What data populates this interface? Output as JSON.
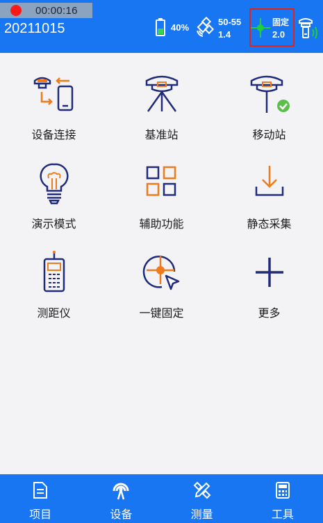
{
  "status_bar": {
    "recording_time": "00:00:16",
    "project_name": "20211015",
    "battery_percent": "40%",
    "satellites": "50-55",
    "pdop": "1.4",
    "fix_status": "固定",
    "fix_value": "2.0"
  },
  "menu": {
    "items": [
      {
        "label": "设备连接",
        "icon": "device-connect-icon"
      },
      {
        "label": "基准站",
        "icon": "base-station-icon"
      },
      {
        "label": "移动站",
        "icon": "rover-icon"
      },
      {
        "label": "演示模式",
        "icon": "demo-mode-icon"
      },
      {
        "label": "辅助功能",
        "icon": "auxiliary-grid-icon"
      },
      {
        "label": "静态采集",
        "icon": "static-download-icon"
      },
      {
        "label": "测距仪",
        "icon": "rangefinder-icon"
      },
      {
        "label": "一键固定",
        "icon": "one-key-fix-icon"
      },
      {
        "label": "更多",
        "icon": "plus-icon"
      }
    ]
  },
  "bottom_nav": {
    "tabs": [
      {
        "label": "项目",
        "icon": "document-icon"
      },
      {
        "label": "设备",
        "icon": "device-signal-icon",
        "active": true
      },
      {
        "label": "测量",
        "icon": "measure-pen-icon"
      },
      {
        "label": "工具",
        "icon": "calculator-icon"
      }
    ]
  },
  "colors": {
    "primary": "#1976f2",
    "accent_orange": "#f07b1d",
    "icon_navy": "#1f2a7a",
    "fix_green": "#1fcf3a",
    "highlight_red": "#e0241b"
  }
}
